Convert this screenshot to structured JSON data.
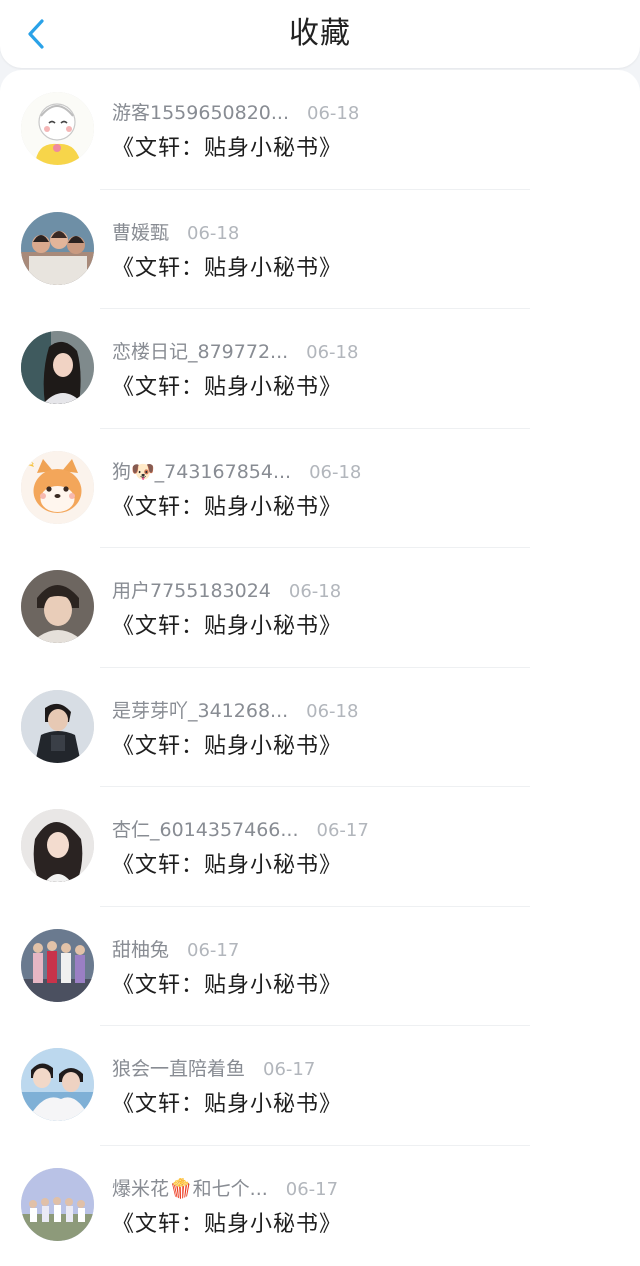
{
  "header": {
    "title": "收藏",
    "back_icon": "chevron-left-icon",
    "accent": "#2aa2e8"
  },
  "items": [
    {
      "name": "游客1559650820...",
      "date": "06-18",
      "content": "《文轩：贴身小秘书》",
      "avatar": "cartoon-girl-avatar"
    },
    {
      "name": "曹媛甄",
      "date": "06-18",
      "content": "《文轩：贴身小秘书》",
      "avatar": "group-photo-avatar"
    },
    {
      "name": "恋楼日记_879772...",
      "date": "06-18",
      "content": "《文轩：贴身小秘书》",
      "avatar": "girl-photo-avatar"
    },
    {
      "name": "狗🐶_743167854...",
      "date": "06-18",
      "content": "《文轩：贴身小秘书》",
      "avatar": "shiba-dog-avatar"
    },
    {
      "name": "用户7755183024",
      "date": "06-18",
      "content": "《文轩：贴身小秘书》",
      "avatar": "boy-portrait-avatar"
    },
    {
      "name": "是芽芽吖_341268...",
      "date": "06-18",
      "content": "《文轩：贴身小秘书》",
      "avatar": "boy-stage-avatar"
    },
    {
      "name": "杏仁_6014357466...",
      "date": "06-17",
      "content": "《文轩：贴身小秘书》",
      "avatar": "girl-portrait-avatar"
    },
    {
      "name": "甜柚兔",
      "date": "06-17",
      "content": "《文轩：贴身小秘书》",
      "avatar": "group-stage-avatar"
    },
    {
      "name": "狼会一直陪着鱼",
      "date": "06-17",
      "content": "《文轩：贴身小秘书》",
      "avatar": "couple-sea-avatar"
    },
    {
      "name": "爆米花🍿和七个...",
      "date": "06-17",
      "content": "《文轩：贴身小秘书》",
      "avatar": "group-sky-avatar"
    }
  ]
}
